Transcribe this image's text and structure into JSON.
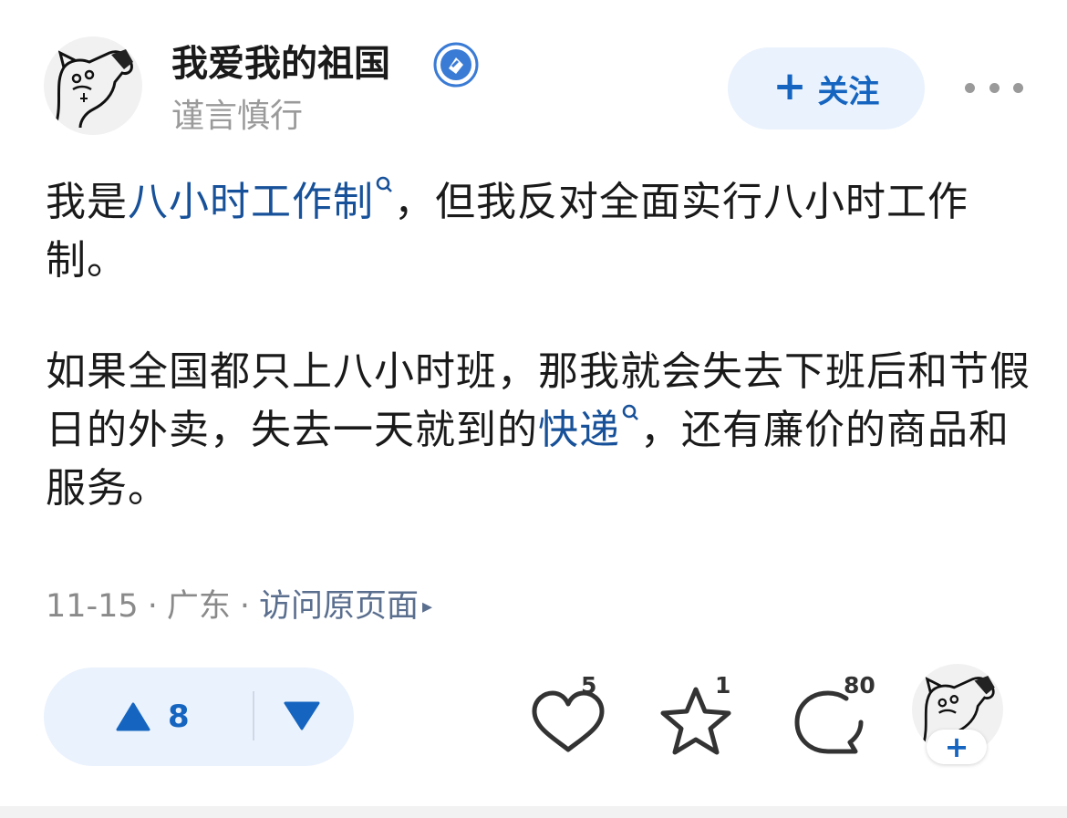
{
  "author": {
    "name": "我爱我的祖国",
    "bio": "谨言慎行",
    "verified_icon": "verified-badge-icon"
  },
  "header": {
    "follow_plus": "+",
    "follow_label": "关注",
    "more_icon": "more-dots-icon"
  },
  "post": {
    "p1": {
      "before": "我是",
      "link": "八小时工作制",
      "after": "，但我反对全面实行八小时工作制。"
    },
    "p2": {
      "before": "如果全国都只上八小时班，那我就会失去下班后和节假日的外卖，失去一天就到的",
      "link": "快递",
      "after": "，还有廉价的商品和服务。"
    }
  },
  "meta": {
    "date": "11-15",
    "location": "广东",
    "visit_label": "访问原页面",
    "sep": "·",
    "arrow": "▸"
  },
  "actions": {
    "upvote_count": "8",
    "like_count": "5",
    "favorite_count": "1",
    "comment_count": "80",
    "follow_plus": "+"
  },
  "colors": {
    "accent": "#1565c0",
    "link": "#175199",
    "pill_bg": "#eaf2fd",
    "muted": "#9a9a9a"
  }
}
